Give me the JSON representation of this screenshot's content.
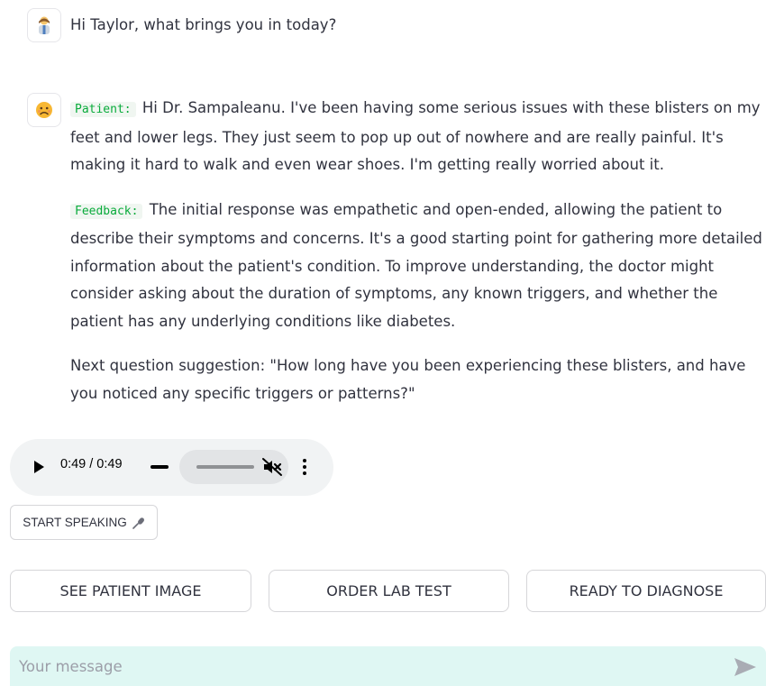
{
  "chat": {
    "doctor_message": "Hi Taylor, what brings you in today?",
    "patient_tag": "Patient:",
    "patient_message": "Hi Dr. Sampaleanu. I've been having some serious issues with these blisters on my feet and lower legs. They just seem to pop up out of nowhere and are really painful. It's making it hard to walk and even wear shoes. I'm getting really worried about it.",
    "feedback_tag": "Feedback:",
    "feedback_message": "The initial response was empathetic and open-ended, allowing the patient to describe their symptoms and concerns. It's a good starting point for gathering more detailed information about the patient's condition. To improve understanding, the doctor might consider asking about the duration of symptoms, any known triggers, and whether the patient has any underlying conditions like diabetes.",
    "next_question": "Next question suggestion: \"How long have you been experiencing these blisters, and have you noticed any specific triggers or patterns?\""
  },
  "audio": {
    "time": "0:49 / 0:49",
    "muted": true
  },
  "buttons": {
    "start_speaking": "START SPEAKING",
    "see_patient_image": "SEE PATIENT IMAGE",
    "order_lab_test": "ORDER LAB TEST",
    "ready_to_diagnose": "READY TO DIAGNOSE"
  },
  "input": {
    "placeholder": "Your message",
    "value": ""
  },
  "icons": {
    "doctor_avatar": "doctor-avatar-icon",
    "patient_avatar": "worried-face-icon",
    "play": "play-icon",
    "mute": "volume-muted-icon",
    "more": "more-vertical-icon",
    "mic": "microphone-icon",
    "send": "send-icon"
  },
  "colors": {
    "tag_text": "#09ab3b",
    "tag_bg": "#f0f6f1",
    "input_bg": "#dff7f3"
  }
}
